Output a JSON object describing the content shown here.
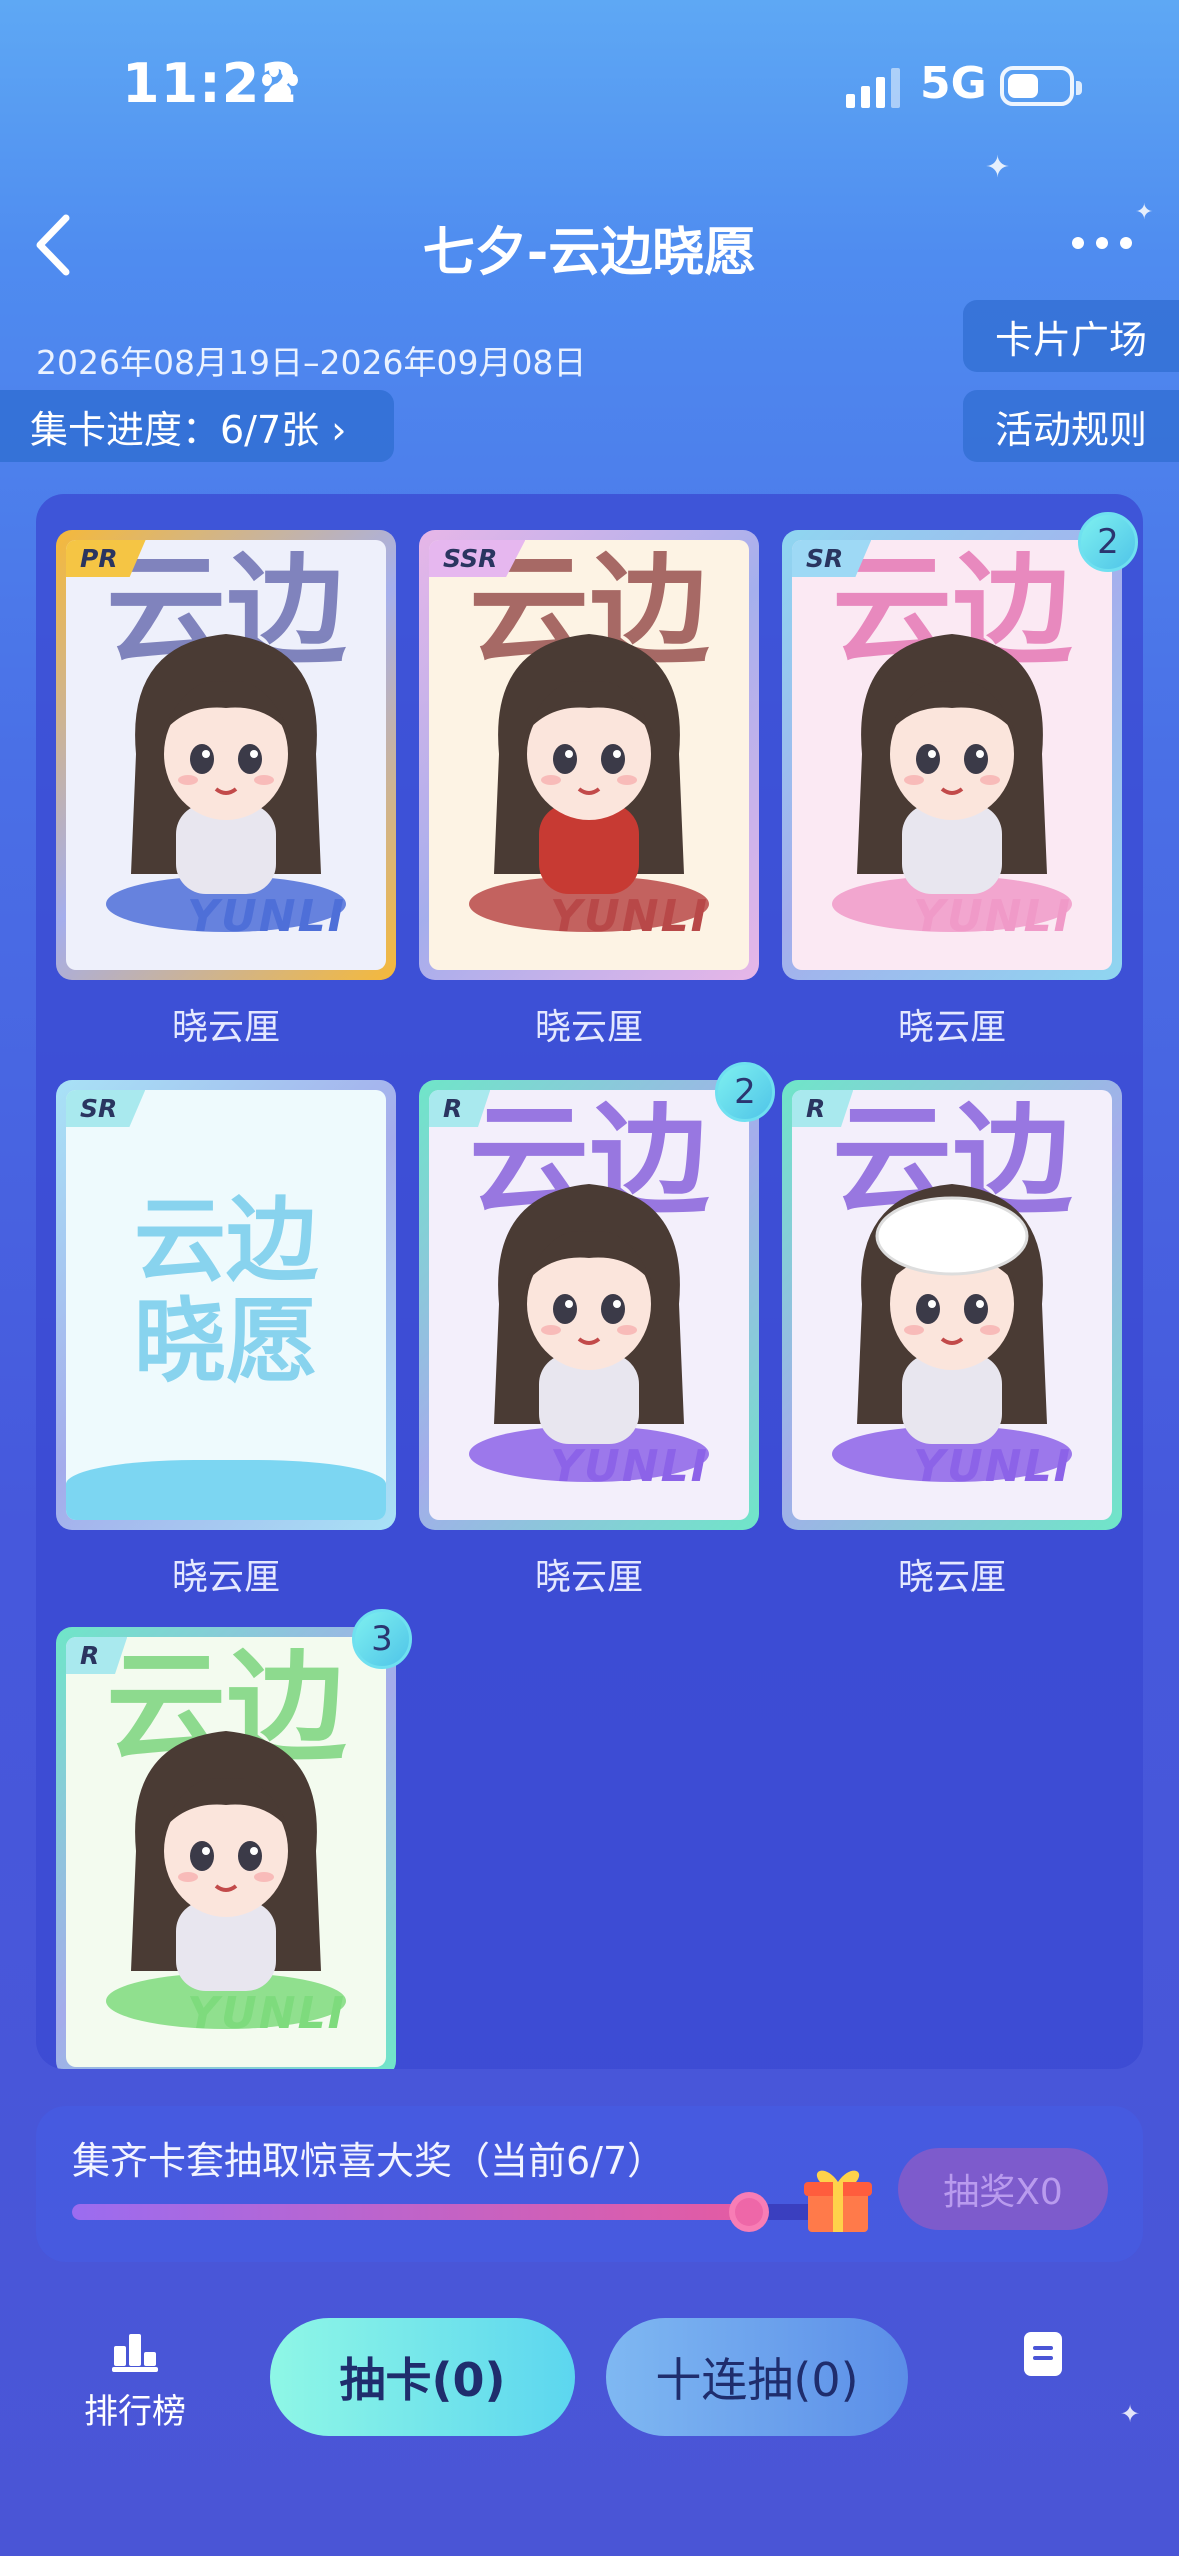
{
  "status_bar": {
    "time": "11:22",
    "network": "5G"
  },
  "header": {
    "title": "七夕-云边晓愿",
    "date_range": "2026年08月19日–2026年09月08日"
  },
  "actions": {
    "card_square": "卡片广场",
    "rules": "活动规则"
  },
  "progress": {
    "label": "集卡进度：6/7张 ›"
  },
  "cards": [
    {
      "rarity": "PR",
      "name": "晓云厘",
      "count": "",
      "big": "云边",
      "yunli": "YUNLI",
      "theme": "#f5b93a"
    },
    {
      "rarity": "SSR",
      "name": "晓云厘",
      "count": "",
      "big": "云边",
      "yunli": "YUNLI",
      "theme": "#e7b6e8"
    },
    {
      "rarity": "SR",
      "name": "晓云厘",
      "count": "2",
      "big": "云边",
      "yunli": "YUNLI",
      "theme": "#8fd6f0"
    },
    {
      "rarity": "SR",
      "name": "晓云厘",
      "count": "",
      "big": "云边晓愿",
      "yunli": "",
      "theme": "#a8e2f6"
    },
    {
      "rarity": "R",
      "name": "晓云厘",
      "count": "2",
      "big": "云边",
      "yunli": "YUNLI",
      "theme": "#6fe6c8"
    },
    {
      "rarity": "R",
      "name": "晓云厘",
      "count": "",
      "big": "云边",
      "yunli": "YUNLI",
      "theme": "#6fe6c8"
    },
    {
      "rarity": "R",
      "name": "",
      "count": "3",
      "big": "云边",
      "yunli": "YUNLI",
      "theme": "#6fe6c8"
    }
  ],
  "prize": {
    "text": "集齐卡套抽取惊喜大奖（当前6/7）",
    "progress": 0.857,
    "draw_label": "抽奖X0"
  },
  "bottom_nav": {
    "rank_label": "排行榜",
    "draw_label": "抽卡(0)",
    "ten_label": "十连抽(0)"
  }
}
